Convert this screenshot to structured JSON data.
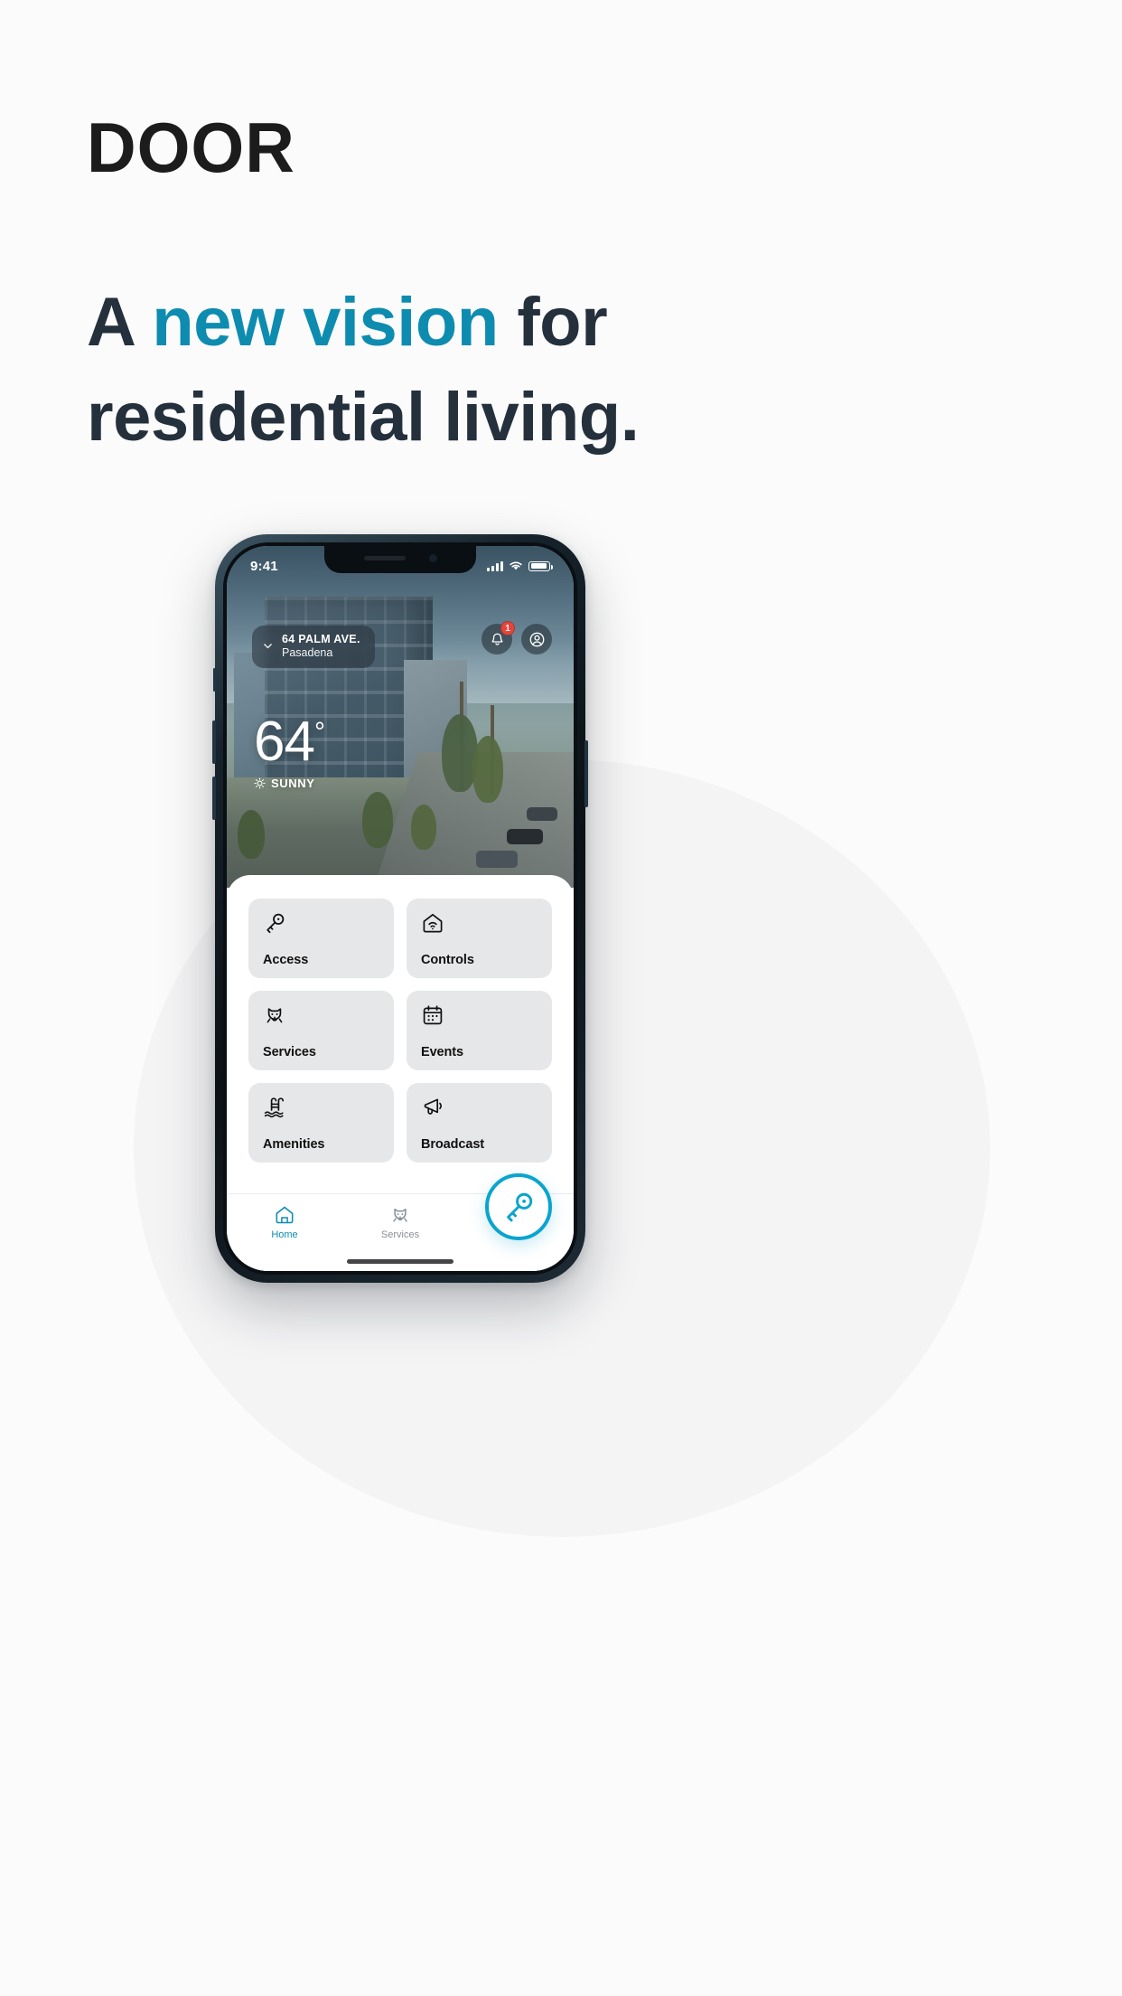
{
  "marketing": {
    "brand": "DOOR",
    "headline_prefix": "A ",
    "headline_accent": "new vision",
    "headline_mid": " for",
    "headline_line2": "residential living.",
    "accent_color": "#0d8cb0",
    "text_color": "#25303d"
  },
  "phone": {
    "status": {
      "time": "9:41",
      "signal_icon": "cellular-bars-icon",
      "wifi_icon": "wifi-icon",
      "battery_icon": "battery-icon"
    },
    "header": {
      "chevron_icon": "chevron-down-icon",
      "address_line1": "64 PALM AVE.",
      "address_line2": "Pasadena",
      "bell_icon": "bell-icon",
      "bell_badge": "1",
      "profile_icon": "user-circle-icon"
    },
    "weather": {
      "temperature": "64",
      "degree": "°",
      "condition": "SUNNY",
      "condition_icon": "sun-icon"
    },
    "tiles": [
      {
        "label": "Access",
        "icon": "key-icon"
      },
      {
        "label": "Controls",
        "icon": "smart-home-icon"
      },
      {
        "label": "Services",
        "icon": "dog-icon"
      },
      {
        "label": "Events",
        "icon": "calendar-icon"
      },
      {
        "label": "Amenities",
        "icon": "pool-icon"
      },
      {
        "label": "Broadcast",
        "icon": "megaphone-icon"
      }
    ],
    "nav": [
      {
        "label": "Home",
        "icon": "home-icon",
        "active": true
      },
      {
        "label": "Services",
        "icon": "dog-icon",
        "active": false
      }
    ],
    "fab": {
      "icon": "key-icon",
      "color": "#0aa4cf"
    }
  }
}
